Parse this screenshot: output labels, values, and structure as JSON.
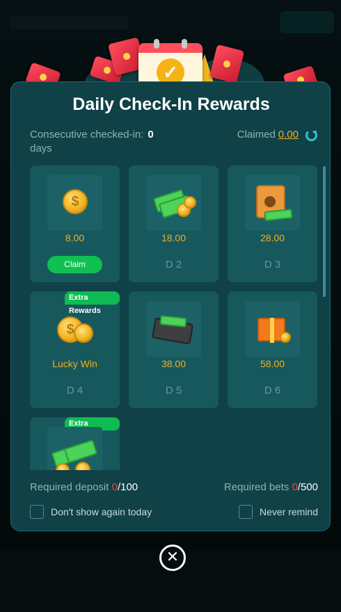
{
  "modal": {
    "title": "Daily Check-In Rewards",
    "consecutive_label": "Consecutive checked-in:",
    "consecutive_value": "0",
    "consecutive_unit": "days",
    "claimed_label": "Claimed",
    "claimed_value": "0.00",
    "refresh_icon": "refresh-icon"
  },
  "days": [
    {
      "amount": "8.00",
      "day": "",
      "button": "Claim",
      "icon": "coin-icon"
    },
    {
      "amount": "18.00",
      "day": "D 2",
      "icon": "cash-coins-icon"
    },
    {
      "amount": "28.00",
      "day": "D 3",
      "icon": "safe-icon"
    },
    {
      "amount": "Lucky Win",
      "day": "D 4",
      "tag": "Extra Rewards",
      "icon": "coin-stack-icon"
    },
    {
      "amount": "38.00",
      "day": "D 5",
      "icon": "cash-briefcase-icon"
    },
    {
      "amount": "58.00",
      "day": "D 6",
      "icon": "gift-box-icon"
    },
    {
      "tag": "Extra Rewards",
      "icon": "cash-pile-icon"
    }
  ],
  "requirements": {
    "deposit_label": "Required deposit",
    "deposit_current": "0",
    "deposit_total": "/100",
    "bets_label": "Required bets",
    "bets_current": "0",
    "bets_total": "/500"
  },
  "options": {
    "dont_show_today": "Don't show again today",
    "never_remind": "Never remind"
  },
  "close_icon": "close-icon",
  "colors": {
    "accent_gold": "#f2b01e",
    "claim_green": "#0ec150",
    "modal_bg": "#0f4147",
    "card_bg": "#17585d"
  }
}
